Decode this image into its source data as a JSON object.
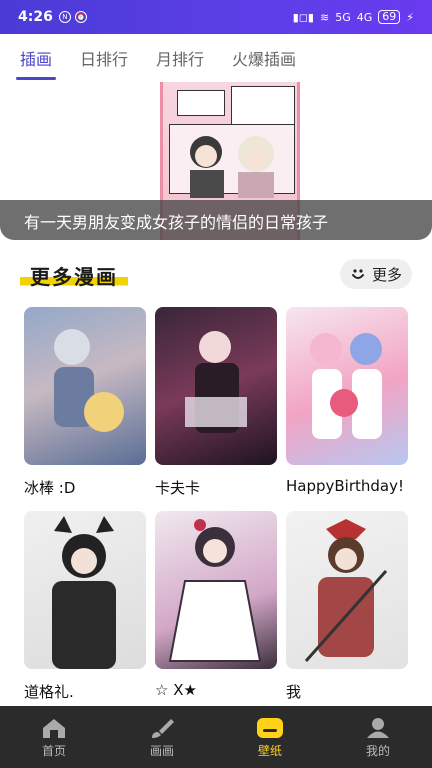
{
  "status_bar": {
    "time": "4:26",
    "battery": "69",
    "network_1": "5G",
    "network_2": "4G"
  },
  "tabs": [
    {
      "label": "插画",
      "active": true
    },
    {
      "label": "日排行",
      "active": false
    },
    {
      "label": "月排行",
      "active": false
    },
    {
      "label": "火爆插画",
      "active": false
    }
  ],
  "banner": {
    "caption": "有一天男朋友变成女孩子的情侣的日常孩子",
    "dots_total": 3,
    "dots_active": 3
  },
  "section": {
    "title": "更多漫画",
    "more_label": "更多"
  },
  "cards": [
    {
      "label": "冰棒 :D",
      "palette": [
        "#93a8c8",
        "#c7b9c2",
        "#5a6e95"
      ]
    },
    {
      "label": "卡夫卡",
      "palette": [
        "#3a2638",
        "#7a3a5a",
        "#1d1420"
      ]
    },
    {
      "label": "HappyBirthday!",
      "palette": [
        "#f7e6ee",
        "#f2a4c4",
        "#b8c7f0"
      ]
    },
    {
      "label": "道格礼.",
      "palette": [
        "#eaeaea",
        "#2a2a2a",
        "#555555"
      ]
    },
    {
      "label": "☆ X★",
      "palette": [
        "#f0e9ef",
        "#d3a7c7",
        "#3b2f3c"
      ]
    },
    {
      "label": "我",
      "palette": [
        "#e8e8e8",
        "#a34646",
        "#5a3b2c"
      ]
    }
  ],
  "bottom_nav": [
    {
      "label": "首页",
      "icon": "home-icon",
      "active": false
    },
    {
      "label": "画画",
      "icon": "brush-icon",
      "active": false
    },
    {
      "label": "壁纸",
      "icon": "wallpaper-icon",
      "active": true
    },
    {
      "label": "我的",
      "icon": "user-icon",
      "active": false
    }
  ],
  "colors": {
    "accent": "#4a46c9",
    "status_bar": "#5b3fe6",
    "nav_active": "#ffd21a",
    "nav_bg": "#2b2b2b"
  }
}
